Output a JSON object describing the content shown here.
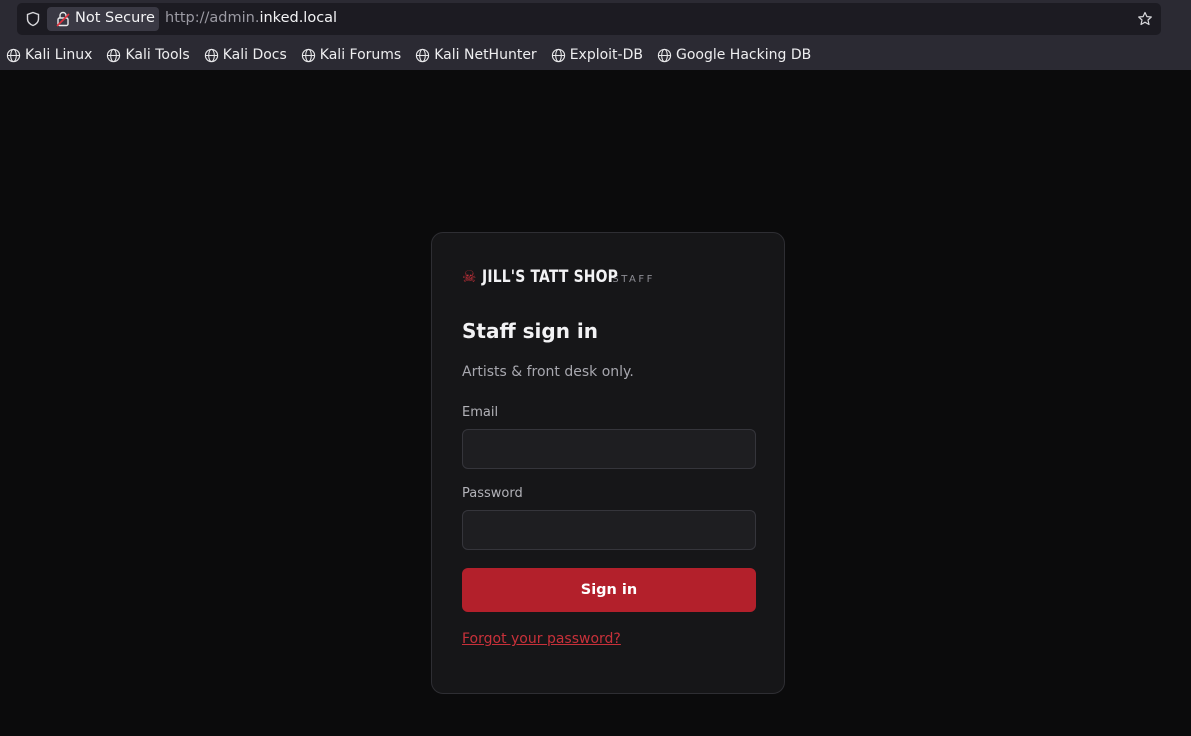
{
  "browser": {
    "security_label": "Not Secure",
    "url_prefix": "http://admin.",
    "url_domain": "inked.local",
    "bookmarks": [
      {
        "label": "Kali Linux"
      },
      {
        "label": "Kali Tools"
      },
      {
        "label": "Kali Docs"
      },
      {
        "label": "Kali Forums"
      },
      {
        "label": "Kali NetHunter"
      },
      {
        "label": "Exploit-DB"
      },
      {
        "label": "Google Hacking DB"
      }
    ]
  },
  "login": {
    "brand_icon": "☠",
    "brand_name": "JILL'S TATT SHOP",
    "brand_tag": "STAFF",
    "title": "Staff sign in",
    "subtitle": "Artists & front desk only.",
    "email_label": "Email",
    "email_value": "",
    "password_label": "Password",
    "password_value": "",
    "submit_label": "Sign in",
    "forgot_label": "Forgot your password?"
  },
  "colors": {
    "accent": "#b3202b",
    "link": "#c8313a",
    "background": "#0b0b0c",
    "card": "#161618"
  }
}
